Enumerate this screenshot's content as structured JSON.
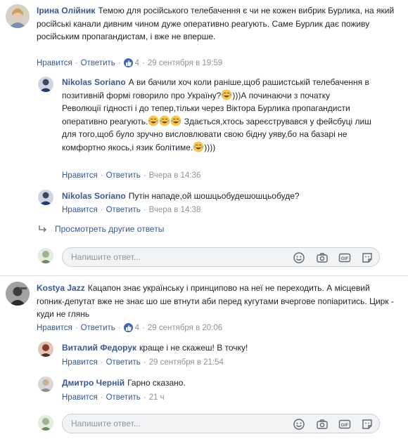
{
  "actions": {
    "like": "Нравится",
    "reply": "Ответить"
  },
  "c1": {
    "author": "Ірина Олійник",
    "text": "Темою для російського телебачення є чи не кожен вибрик Бурлика, на який російські канали дивним чином дуже оперативно реагують. Саме Бурлик дає поживу російським пропагандистам, і вже не вперше.",
    "likes": "4",
    "time": "29 сентября в 19:59"
  },
  "r1": {
    "author": "Nikolas Soriano",
    "text1": "А ви бачили хоч коли раніше,щоб рашистській телебачення в позитивній формі говорило про Україну?",
    "text2": ")))А починаючи з початку Революції гідності і до тепер,тільки через Віктора Бурлика пропагандисти оперативно реагують.",
    "text3": "Здається,хтось зареєструвався у фейсбуці лиш для того,щоб було зручно висловлювати свою бідну уяву,бо на базарі не комфортно якось,і язик болітиме.",
    "text4": "))))",
    "time": "Вчера в 14:36"
  },
  "r2": {
    "author": "Nikolas Soriano",
    "text": "Путін нападе,ой шошцьобудешошцьобуде?",
    "time": "Вчера в 14:38"
  },
  "more_replies": "Просмотреть другие ответы",
  "reply_placeholder": "Напишите ответ...",
  "c2": {
    "author": "Kostya Jazz",
    "text": "Кацапон знає українську і принципово на неї не переходить. А місцевий гопник-депутат вже не знає шо ше втнути аби перед кугутами вчергове попіаритись. Цирк - куди не глянь",
    "likes": "4",
    "time": "29 сентября в 20:06"
  },
  "r3": {
    "author": "Виталий Федорук",
    "text": "краще і не скажеш! В точку!",
    "time": "29 сентября в 21:54"
  },
  "r4": {
    "author": "Дмитро Черній",
    "text": "Гарно сказано.",
    "time": "21 ч"
  },
  "colors": {
    "link": "#385898",
    "meta": "#90949c",
    "like": "#4267b2",
    "divider": "#dddfe2"
  },
  "icons": [
    "like-icon",
    "laugh-emoji-icon",
    "smiley-icon",
    "camera-icon",
    "gif-icon",
    "sticker-icon",
    "reply-arrow-icon"
  ]
}
